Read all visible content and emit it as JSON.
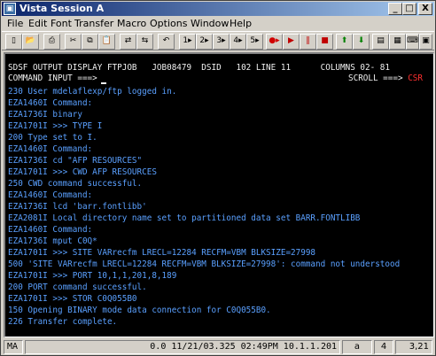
{
  "window": {
    "title": "Vista Session A",
    "app_icon": "terminal-icon",
    "controls": {
      "minimize": "_",
      "maximize": "□",
      "close": "X"
    }
  },
  "menubar": [
    "File",
    "Edit",
    "Font",
    "Transfer",
    "Macro",
    "Options",
    "Window",
    "Help"
  ],
  "toolbar": [
    {
      "name": "new-session-icon",
      "glyph": "▯"
    },
    {
      "name": "open-icon",
      "glyph": "📂"
    },
    {
      "name": "print-icon",
      "glyph": "⎙"
    },
    {
      "name": "cut-icon",
      "glyph": "✂"
    },
    {
      "name": "copy-icon",
      "glyph": "⧉"
    },
    {
      "name": "paste-icon",
      "glyph": "📋"
    },
    {
      "name": "connect-icon",
      "glyph": "⇄"
    },
    {
      "name": "disconnect-icon",
      "glyph": "⇆"
    },
    {
      "name": "undo-icon",
      "glyph": "↶"
    },
    {
      "name": "macro-1-button",
      "glyph": "1▸"
    },
    {
      "name": "macro-2-button",
      "glyph": "2▸"
    },
    {
      "name": "macro-3-button",
      "glyph": "3▸"
    },
    {
      "name": "macro-4-button",
      "glyph": "4▸"
    },
    {
      "name": "macro-5-button",
      "glyph": "5▸"
    },
    {
      "name": "record-icon",
      "glyph": "●▸"
    },
    {
      "name": "play-icon",
      "glyph": "▶"
    },
    {
      "name": "pause-icon",
      "glyph": "‖"
    },
    {
      "name": "stop-icon",
      "glyph": "■"
    },
    {
      "name": "arrow-up-icon",
      "glyph": "⬆"
    },
    {
      "name": "arrow-down-icon",
      "glyph": "⬇"
    },
    {
      "name": "properties-icon",
      "glyph": "▤"
    },
    {
      "name": "settings-icon",
      "glyph": "▦"
    },
    {
      "name": "keyboard-icon",
      "glyph": "⌨"
    },
    {
      "name": "help-icon",
      "glyph": "▣"
    }
  ],
  "terminal": {
    "header_line1": "SDSF OUTPUT DISPLAY FTPJOB   JOB08479  DSID   102 LINE 11      COLUMNS 02- 81",
    "header_line2_prefix": "COMMAND INPUT ===>",
    "scroll_label": "SCROLL ===>",
    "scroll_value": "CSR",
    "lines": [
      "230 User mdelaflexp/ftp logged in.",
      "EZA1460I Command:",
      "EZA1736I binary",
      "EZA1701I >>> TYPE I",
      "200 Type set to I.",
      "EZA1460I Command:",
      "EZA1736I cd \"AFP RESOURCES\"",
      "EZA1701I >>> CWD AFP RESOURCES",
      "250 CWD command successful.",
      "EZA1460I Command:",
      "EZA1736I lcd 'barr.fontlibb'",
      "EZA2081I Local directory name set to partitioned data set BARR.FONTLIBB",
      "EZA1460I Command:",
      "EZA1736I mput C0Q*",
      "EZA1701I >>> SITE VARrecfm LRECL=12284 RECFM=VBM BLKSIZE=27998",
      "500 'SITE VARrecfm LRECL=12284 RECFM=VBM BLKSIZE=27998': command not understood",
      "EZA1701I >>> PORT 10,1,1,201,8,189",
      "200 PORT command successful.",
      "EZA1701I >>> STOR C0Q055B0",
      "150 Opening BINARY mode data connection for C0Q055B0.",
      "226 Transfer complete."
    ]
  },
  "statusbar": {
    "session_indicator": "MA",
    "connection_info": "0.0 11/21/03.325 02:49PM 10.1.1.201",
    "mode_icon": "a",
    "input_mode": "4",
    "cursor_position": "3,21"
  },
  "colors": {
    "terminal_bg": "#000000",
    "terminal_text": "#5aa0ff",
    "header_text": "#f0f0f0",
    "scroll_value": "#ff3030"
  }
}
